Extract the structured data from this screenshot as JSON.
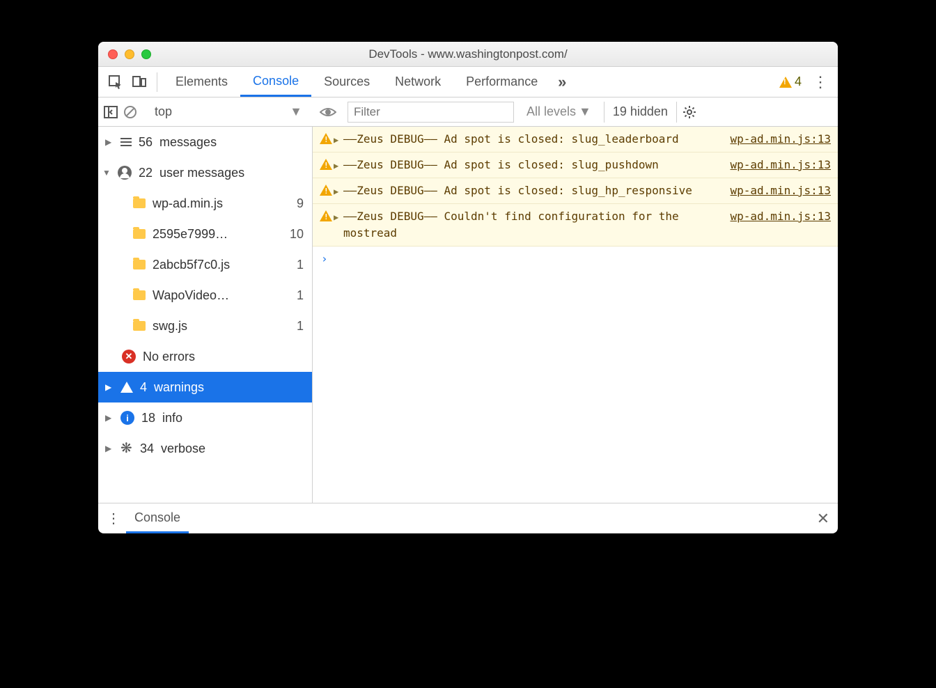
{
  "window": {
    "title": "DevTools - www.washingtonpost.com/"
  },
  "tabs": {
    "elements": "Elements",
    "console": "Console",
    "sources": "Sources",
    "network": "Network",
    "performance": "Performance",
    "warn_count": "4"
  },
  "toolbar": {
    "context": "top",
    "filter_placeholder": "Filter",
    "levels": "All levels",
    "hidden": "19 hidden"
  },
  "sidebar": {
    "messages": {
      "count": "56",
      "label": "messages"
    },
    "user_messages": {
      "count": "22",
      "label": "user messages"
    },
    "files": [
      {
        "name": "wp-ad.min.js",
        "count": "9"
      },
      {
        "name": "2595e7999…",
        "count": "10"
      },
      {
        "name": "2abcb5f7c0.js",
        "count": "1"
      },
      {
        "name": "WapoVideo…",
        "count": "1"
      },
      {
        "name": "swg.js",
        "count": "1"
      }
    ],
    "errors": {
      "label": "No errors"
    },
    "warnings": {
      "count": "4",
      "label": "warnings"
    },
    "info": {
      "count": "18",
      "label": "info"
    },
    "verbose": {
      "count": "34",
      "label": "verbose"
    }
  },
  "logs": [
    {
      "msg": "––Zeus DEBUG–– Ad spot is closed: slug_leaderboard",
      "src": "wp-ad.min.js:13"
    },
    {
      "msg": "––Zeus DEBUG–– Ad spot is closed: slug_pushdown",
      "src": "wp-ad.min.js:13"
    },
    {
      "msg": "––Zeus DEBUG–– Ad spot is closed: slug_hp_responsive",
      "src": "wp-ad.min.js:13"
    },
    {
      "msg": "––Zeus DEBUG–– Couldn't find configuration for the mostread",
      "src": "wp-ad.min.js:13"
    }
  ],
  "drawer": {
    "tab": "Console"
  }
}
